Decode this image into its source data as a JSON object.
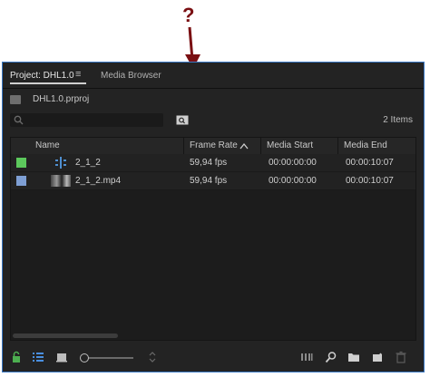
{
  "annotation": {
    "label": "?"
  },
  "tabs": {
    "project": "Project: DHL1.0",
    "menu_glyph": "≡",
    "media_browser": "Media Browser"
  },
  "project_file": "DHL1.0.prproj",
  "search": {
    "placeholder": ""
  },
  "item_count": "2 Items",
  "columns": [
    "Name",
    "Frame Rate",
    "Media Start",
    "Media End"
  ],
  "rows": [
    {
      "name": "2_1_2",
      "frame_rate": "59,94 fps",
      "media_start": "00:00:00:00",
      "media_end": "00:00:10:07",
      "label_color": "#5cc85c",
      "type_icon": "sequence-icon"
    },
    {
      "name": "2_1_2.mp4",
      "frame_rate": "59,94 fps",
      "media_start": "00:00:00:00",
      "media_end": "00:00:10:07",
      "label_color": "#7e9fd4",
      "type_icon": "video-thumbnail"
    }
  ],
  "colors": {
    "accent": "#3a78c4",
    "annotation": "#7a0f12",
    "lock": "#4caf50",
    "list_view": "#4a8fe0"
  }
}
